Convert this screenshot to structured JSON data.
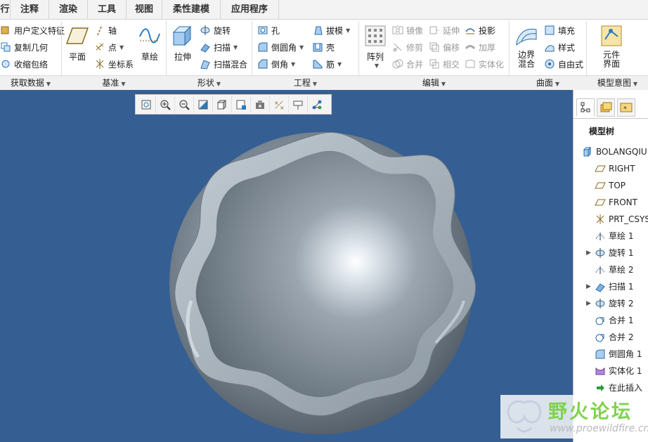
{
  "menu_tabs": [
    "行",
    "注释",
    "渲染",
    "工具",
    "视图",
    "柔性建模",
    "应用程序"
  ],
  "ribbon": {
    "get_data": {
      "items": [
        "用户定义特征",
        "复制几何",
        "收缩包络"
      ],
      "group_label": "获取数据"
    },
    "datum": {
      "plane": "平面",
      "axis": "轴",
      "point": "点",
      "csys": "坐标系",
      "sketch": "草绘",
      "group_label": "基准"
    },
    "shapes": {
      "extrude": "拉伸",
      "revolve": "旋转",
      "sweep": "扫描",
      "swept_blend": "扫描混合",
      "group_label": "形状"
    },
    "engineering": {
      "hole": "孔",
      "round": "倒圆角",
      "chamfer": "倒角",
      "draft": "拔模",
      "shell": "壳",
      "rib": "筋",
      "group_label": "工程"
    },
    "editing": {
      "pattern": "阵列",
      "mirror": "镜像",
      "trim": "修剪",
      "merge": "合并",
      "extend": "延伸",
      "offset": "偏移",
      "intersect": "相交",
      "project": "投影",
      "thicken": "加厚",
      "solidify": "实体化",
      "group_label": "编辑"
    },
    "surfaces": {
      "boundary_blend": [
        "边界",
        "混合"
      ],
      "fill": "填充",
      "style": "样式",
      "freestyle": "自由式",
      "group_label": "曲面"
    },
    "model_intent": {
      "component_interface": [
        "元件",
        "界面"
      ],
      "group_label": "模型意图"
    }
  },
  "view_toolbar": [
    "refit-icon",
    "zoom-in-icon",
    "zoom-out-icon",
    "repaint-icon",
    "display-style-icon",
    "saved-views-icon",
    "view-manager-icon",
    "datum-display-icon",
    "annotation-display-icon",
    "spin-center-icon"
  ],
  "model_tree": {
    "title": "模型树",
    "items": [
      {
        "label": "BOLANGQIU",
        "icon": "part-icon",
        "expandable": false
      },
      {
        "label": "RIGHT",
        "icon": "datum-plane-icon",
        "expandable": false
      },
      {
        "label": "TOP",
        "icon": "datum-plane-icon",
        "expandable": false
      },
      {
        "label": "FRONT",
        "icon": "datum-plane-icon",
        "expandable": false
      },
      {
        "label": "PRT_CSYS",
        "icon": "csys-icon",
        "expandable": false
      },
      {
        "label": "草绘 1",
        "icon": "sketch-icon",
        "expandable": false
      },
      {
        "label": "旋转 1",
        "icon": "revolve-icon",
        "expandable": true
      },
      {
        "label": "草绘 2",
        "icon": "sketch-icon",
        "expandable": false
      },
      {
        "label": "扫描 1",
        "icon": "sweep-icon",
        "expandable": true
      },
      {
        "label": "旋转 2",
        "icon": "revolve-icon",
        "expandable": true
      },
      {
        "label": "合并 1",
        "icon": "merge-icon",
        "expandable": false
      },
      {
        "label": "合并 2",
        "icon": "merge-icon",
        "expandable": false
      },
      {
        "label": "倒圆角 1",
        "icon": "round-icon",
        "expandable": false
      },
      {
        "label": "实体化 1",
        "icon": "solidify-icon",
        "expandable": false
      },
      {
        "label": "在此插入",
        "icon": "insert-here-icon",
        "expandable": false
      }
    ]
  },
  "watermark": {
    "text": "野火论坛",
    "url": "www.proewildfire.cn"
  },
  "colors": {
    "viewport_bg": "#355f93",
    "model_fill": "#7d8a95",
    "accent": "#2a7ac0"
  }
}
